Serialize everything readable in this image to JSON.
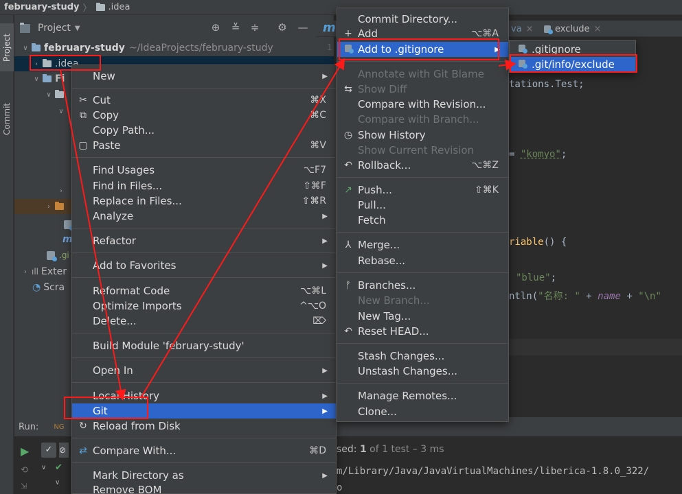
{
  "breadcrumb": {
    "project": "february-study",
    "folder": ".idea"
  },
  "left_strip": {
    "project_tab": "Project",
    "commit_tab": "Commit"
  },
  "project_panel": {
    "title": "Project",
    "tree": {
      "root_name": "february-study",
      "root_path": "~/IdeaProjects/february-study",
      "idea_folder": ".idea",
      "partial_fi": "Fi",
      "partial_m": "m",
      "partial_gi": ".gi",
      "external": "Exter",
      "scratches": "Scra"
    }
  },
  "editor": {
    "tab_java": "va",
    "tab_exclude": "exclude",
    "gutter_line": "1",
    "gutter_m": "m",
    "code": {
      "line1": "tations.Test;",
      "line2_eq": "= ",
      "line2_str": "\"komyo\"",
      "line2_end": ";",
      "line3_fn": "riable",
      "line3_end": "() {",
      "line4_str": "\"blue\"",
      "line4_end": ";",
      "line5_a": "ntln(",
      "line5_str": "\"名称: \"",
      "line5_b": " + ",
      "line5_var": "name",
      "line5_c": " + ",
      "line5_str2": "\"\\n\""
    }
  },
  "run_panel": {
    "label": "Run:",
    "status_prefix": "sed: ",
    "status_count": "1",
    "status_rest": " of 1 test – 3 ms",
    "path": "m/Library/Java/JavaVirtualMachines/liberica-1.8.0_322/",
    "last": "o"
  },
  "context_menu": {
    "new": "New",
    "cut": "Cut",
    "cut_sc": "⌘X",
    "copy": "Copy",
    "copy_sc": "⌘C",
    "copy_path": "Copy Path...",
    "paste": "Paste",
    "paste_sc": "⌘V",
    "find_usages": "Find Usages",
    "find_usages_sc": "⌥F7",
    "find_in_files": "Find in Files...",
    "find_in_files_sc": "⇧⌘F",
    "replace_in_files": "Replace in Files...",
    "replace_in_files_sc": "⇧⌘R",
    "analyze": "Analyze",
    "refactor": "Refactor",
    "add_to_favorites": "Add to Favorites",
    "reformat_code": "Reformat Code",
    "reformat_code_sc": "⌥⌘L",
    "optimize_imports": "Optimize Imports",
    "optimize_imports_sc": "^⌥O",
    "delete": "Delete...",
    "delete_sc": "⌦",
    "build_module": "Build Module 'february-study'",
    "open_in": "Open In",
    "local_history": "Local History",
    "git": "Git",
    "reload_from_disk": "Reload from Disk",
    "compare_with": "Compare With...",
    "compare_with_sc": "⌘D",
    "mark_directory_as": "Mark Directory as",
    "remove_bom": "Remove BOM"
  },
  "git_menu": {
    "commit_directory": "Commit Directory...",
    "add": "Add",
    "add_sc": "⌥⌘A",
    "add_to_gitignore": "Add to .gitignore",
    "annotate": "Annotate with Git Blame",
    "show_diff": "Show Diff",
    "compare_with_revision": "Compare with Revision...",
    "compare_with_branch": "Compare with Branch...",
    "show_history": "Show History",
    "show_current_revision": "Show Current Revision",
    "rollback": "Rollback...",
    "rollback_sc": "⌥⌘Z",
    "push": "Push...",
    "push_sc": "⇧⌘K",
    "pull": "Pull...",
    "fetch": "Fetch",
    "merge": "Merge...",
    "rebase": "Rebase...",
    "branches": "Branches...",
    "new_branch": "New Branch...",
    "new_tag": "New Tag...",
    "reset_head": "Reset HEAD...",
    "stash_changes": "Stash Changes...",
    "unstash_changes": "Unstash Changes...",
    "manage_remotes": "Manage Remotes...",
    "clone": "Clone..."
  },
  "gitignore_menu": {
    "gitignore": ".gitignore",
    "git_info_exclude": ".git/info/exclude"
  },
  "colors": {
    "menu_bg": "#3c3f41",
    "selection": "#2e65ca",
    "annotation_red": "#ff1a1a"
  }
}
